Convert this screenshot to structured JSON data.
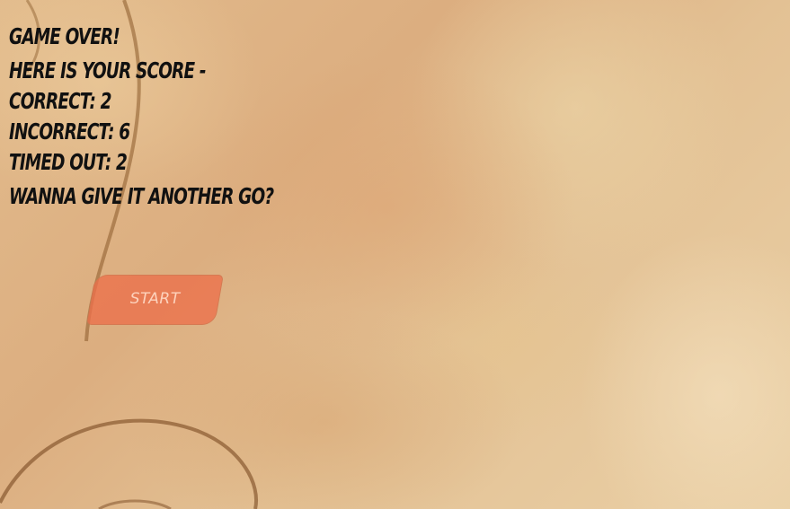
{
  "game": {
    "title": "GAME OVER!",
    "score_heading": "HERE IS YOUR SCORE -",
    "correct": "CORRECT: 2",
    "incorrect": "INCORRECT: 6",
    "timed_out": "TIMED OUT: 2",
    "prompt": "WANNA GIVE IT ANOTHER GO?"
  },
  "start_button": {
    "label": "START"
  },
  "colors": {
    "button": "#ec704a",
    "text": "#111111",
    "background": "#e2bb8c"
  }
}
